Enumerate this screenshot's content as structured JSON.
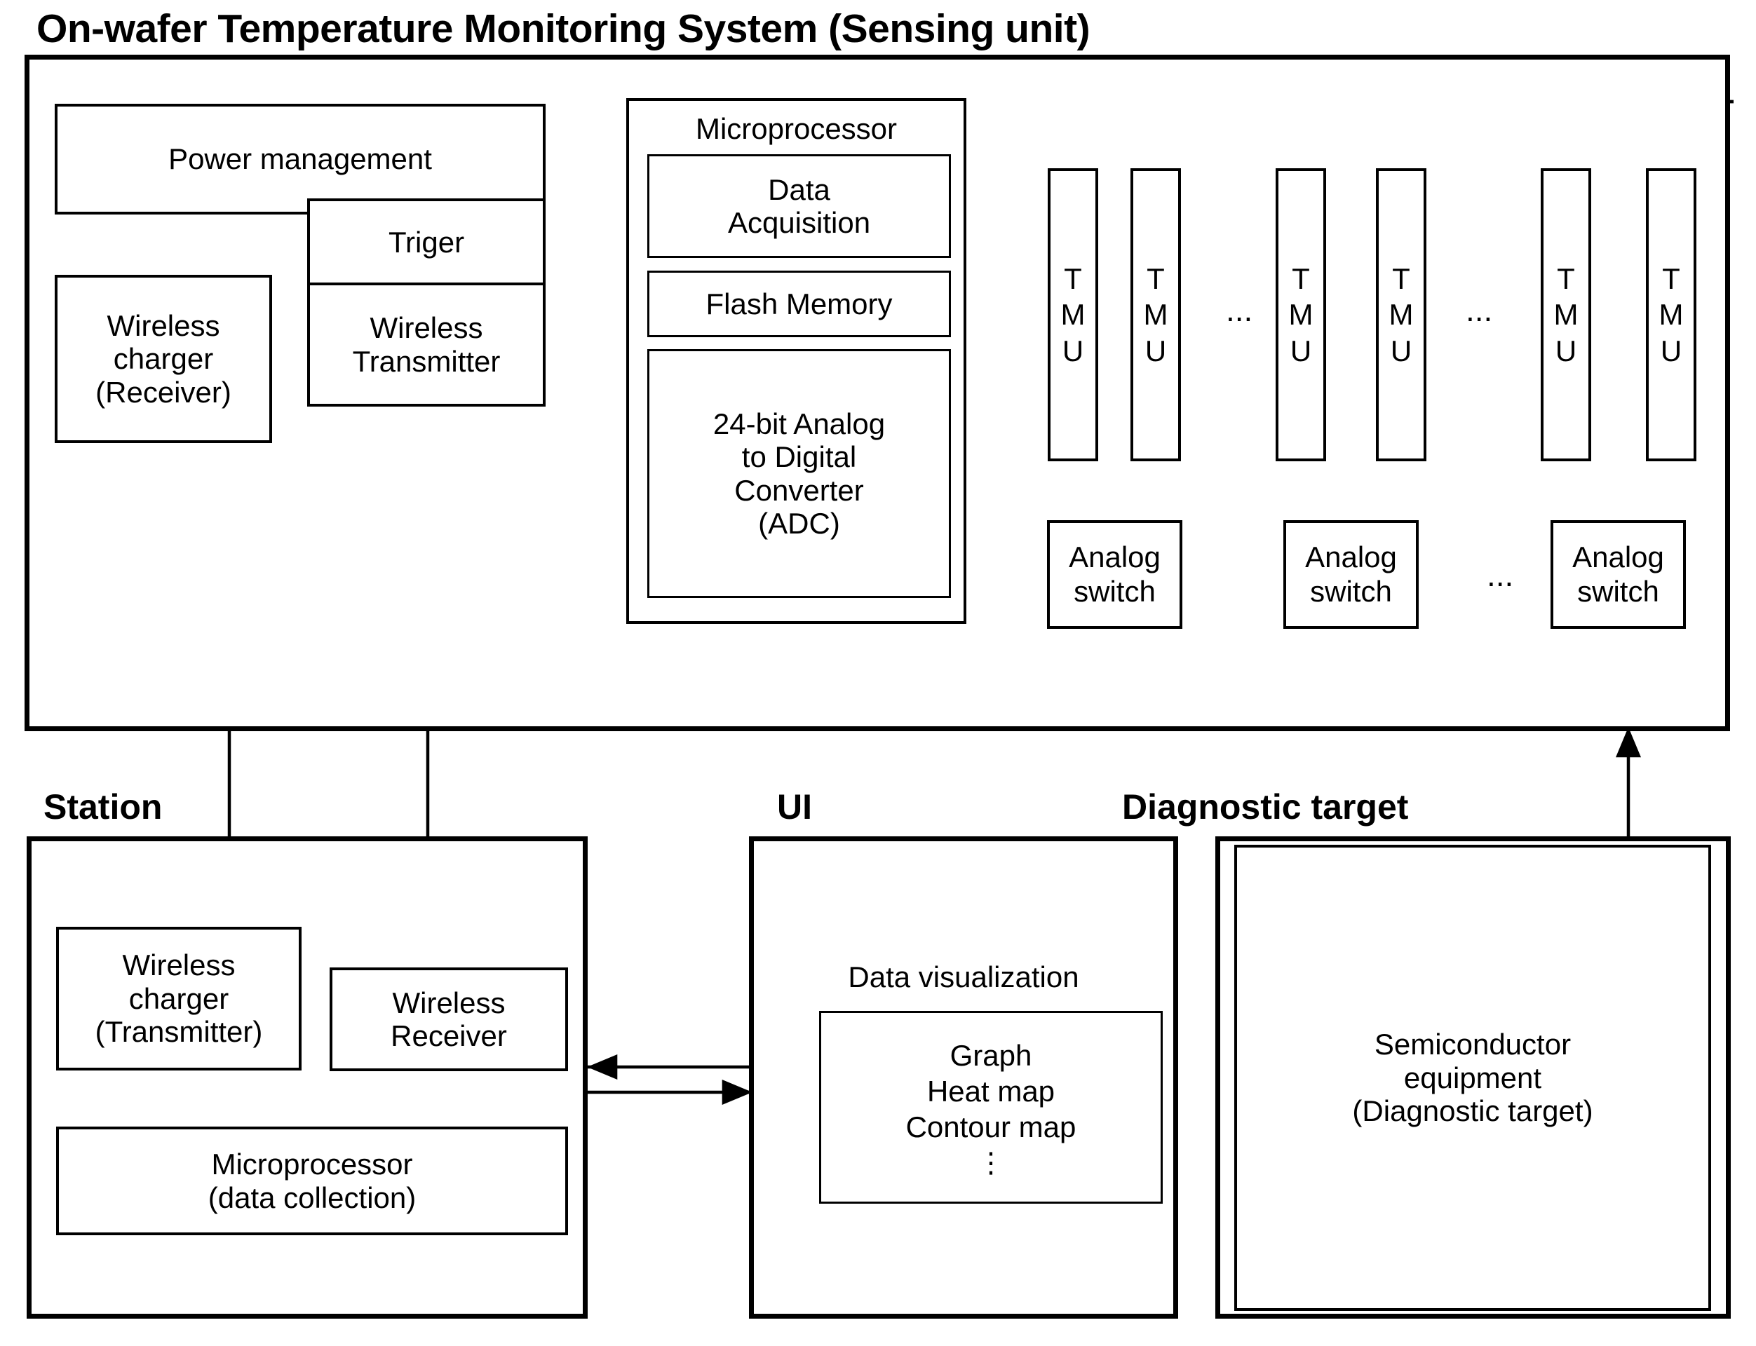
{
  "title": "On-wafer Temperature Monitoring System (Sensing unit)",
  "sections": {
    "station": "Station",
    "ui": "UI",
    "diagnostic": "Diagnostic target"
  },
  "sensing_unit": {
    "power_management": "Power management",
    "triger": "Triger",
    "wireless_charger_receiver": "Wireless\ncharger\n(Receiver)",
    "wireless_transmitter": "Wireless\nTransmitter",
    "microprocessor": {
      "title": "Microprocessor",
      "data_acquisition": "Data\nAcquisition",
      "flash_memory": "Flash Memory",
      "adc": "24-bit Analog\nto Digital\nConverter\n(ADC)"
    },
    "tmu_label_lines": [
      "T",
      "M",
      "U"
    ],
    "tmu_count": 6,
    "analog_switch": "Analog\nswitch",
    "analog_switch_count": 3,
    "ellipsis": "..."
  },
  "station": {
    "wireless_charger_transmitter": "Wireless\ncharger\n(Transmitter)",
    "wireless_receiver": "Wireless\nReceiver",
    "microprocessor_data_collection": "Microprocessor\n(data collection)"
  },
  "ui": {
    "data_visualization": "Data visualization",
    "items": [
      "Graph",
      "Heat map",
      "Contour map"
    ],
    "vertical_ellipsis": "⋮"
  },
  "diagnostic": {
    "semiconductor_equipment": "Semiconductor\nequipment\n(Diagnostic target)"
  },
  "colors": {
    "stroke": "#000000",
    "background": "#ffffff"
  }
}
